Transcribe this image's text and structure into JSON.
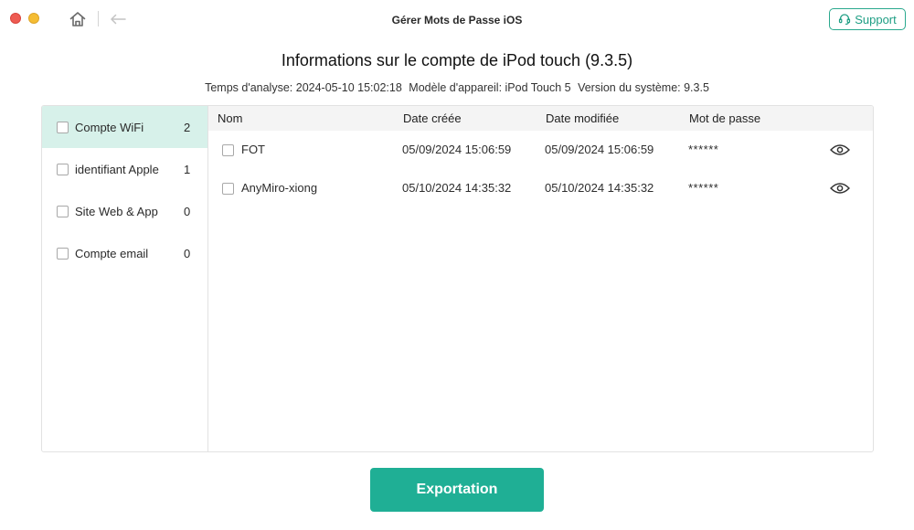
{
  "window": {
    "title": "Gérer Mots de Passe iOS",
    "support_label": "Support"
  },
  "header": {
    "title": "Informations sur le compte de iPod touch (9.3.5)",
    "analysis_time": "Temps d'analyse: 2024-05-10 15:02:18",
    "device_model": "Modèle d'appareil: iPod Touch 5",
    "system_version": "Version du système: 9.3.5"
  },
  "sidebar": {
    "items": [
      {
        "label": "Compte WiFi",
        "count": "2",
        "active": true
      },
      {
        "label": "identifiant Apple",
        "count": "1",
        "active": false
      },
      {
        "label": "Site Web & App",
        "count": "0",
        "active": false
      },
      {
        "label": "Compte email",
        "count": "0",
        "active": false
      }
    ]
  },
  "table": {
    "columns": [
      "Nom",
      "Date créée",
      "Date modifiée",
      "Mot de passe"
    ],
    "rows": [
      {
        "name": "FOT",
        "created": "05/09/2024 15:06:59",
        "modified": "05/09/2024 15:06:59",
        "password": "******"
      },
      {
        "name": "AnyMiro-xiong",
        "created": "05/10/2024 14:35:32",
        "modified": "05/10/2024 14:35:32",
        "password": "******"
      }
    ]
  },
  "footer": {
    "export_label": "Exportation"
  },
  "colors": {
    "accent": "#1faf95",
    "active_row": "#d7f1ea"
  },
  "icons": [
    "home-icon",
    "back-arrow-icon",
    "headset-icon",
    "eye-icon"
  ]
}
